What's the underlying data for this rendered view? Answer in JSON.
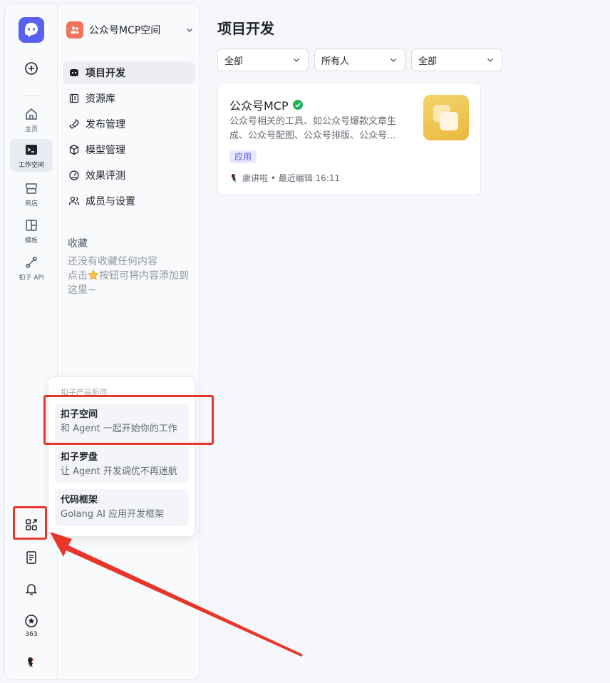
{
  "rail": {
    "items": [
      {
        "label": "主页",
        "icon": "home-icon"
      },
      {
        "label": "工作空间",
        "icon": "terminal-icon"
      },
      {
        "label": "商店",
        "icon": "store-icon"
      },
      {
        "label": "模板",
        "icon": "template-icon"
      },
      {
        "label": "扣子 API",
        "icon": "api-icon"
      }
    ],
    "bottom": {
      "notification_count": "363"
    }
  },
  "sidebar": {
    "space_name": "公众号MCP空间",
    "items": [
      {
        "label": "项目开发",
        "icon": "project-icon"
      },
      {
        "label": "资源库",
        "icon": "library-icon"
      },
      {
        "label": "发布管理",
        "icon": "rocket-icon"
      },
      {
        "label": "模型管理",
        "icon": "cube-icon"
      },
      {
        "label": "效果评测",
        "icon": "gauge-icon"
      },
      {
        "label": "成员与设置",
        "icon": "members-icon"
      }
    ],
    "favorites_title": "收藏",
    "favorites_empty_1": "还没有收藏任何内容",
    "favorites_empty_2a": "点击",
    "favorites_empty_2b": "按钮可将内容添加到",
    "favorites_empty_3": "这里~"
  },
  "main": {
    "title": "项目开发",
    "filters": [
      "全部",
      "所有人",
      "全部"
    ],
    "card": {
      "title": "公众号MCP",
      "description": "公众号相关的工具、如公众号爆款文章生成、公众号配图、公众号排版、公众号...",
      "badge": "应用",
      "author": "康讲啦",
      "meta": "• 最近编辑 16:11"
    }
  },
  "popup": {
    "header": "扣子产品矩阵",
    "items": [
      {
        "title": "扣子空间",
        "desc": "和 Agent 一起开始你的工作"
      },
      {
        "title": "扣子罗盘",
        "desc": "让 Agent 开发调优不再迷航"
      },
      {
        "title": "代码框架",
        "desc": "Golang AI 应用开发框架"
      }
    ]
  },
  "colors": {
    "brand": "#5a60f0",
    "annotation": "#e8352b",
    "badge_bg": "#e8e9ff",
    "verified": "#1fb25a"
  }
}
